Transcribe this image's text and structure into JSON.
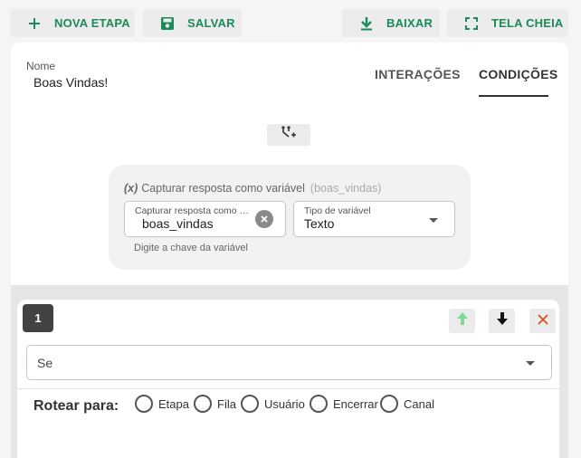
{
  "toolbar": {
    "new_stage": "NOVA ETAPA",
    "save": "SALVAR",
    "download": "BAIXAR",
    "fullscreen": "TELA CHEIA",
    "accent": "#1b8a5a"
  },
  "stage": {
    "name_label": "Nome",
    "name_value": "Boas Vindas!"
  },
  "tabs": [
    {
      "label": "INTERAÇÕES",
      "active": false
    },
    {
      "label": "CONDIÇÕES",
      "active": true
    }
  ],
  "capture": {
    "icon_text": "(x)",
    "title": "Capturar resposta como variável",
    "hint": "(boas_vindas)",
    "variable_field_label": "Capturar resposta como variável",
    "variable_field_value": "boas_vindas",
    "type_field_label": "Tipo de variável",
    "type_field_value": "Texto",
    "helper_text": "Digite a chave da variável"
  },
  "condition": {
    "number": "1",
    "if_select_value": "Se",
    "route_label": "Rotear para:",
    "route_options": [
      "Etapa",
      "Fila",
      "Usuário",
      "Encerrar",
      "Canal"
    ],
    "up_color": "#7ed99b",
    "remove_color": "#d9531e"
  }
}
